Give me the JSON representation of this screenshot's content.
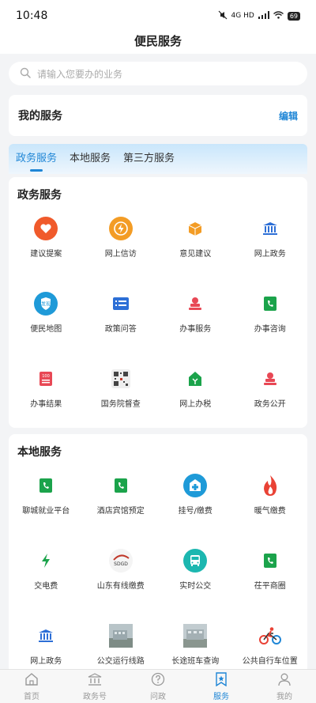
{
  "status": {
    "time": "10:48",
    "network": "4G HD",
    "battery": "69"
  },
  "header": {
    "title": "便民服务"
  },
  "search": {
    "placeholder": "请输入您要办的业务"
  },
  "my_services": {
    "title": "我的服务",
    "edit": "编辑"
  },
  "tabs": [
    {
      "label": "政务服务"
    },
    {
      "label": "本地服务"
    },
    {
      "label": "第三方服务"
    }
  ],
  "gov": {
    "title": "政务服务",
    "items": [
      {
        "label": "建议提案",
        "icon": "heart-icon",
        "color": "#f05a2b"
      },
      {
        "label": "网上信访",
        "icon": "lightning-icon",
        "color": "#f39c25"
      },
      {
        "label": "意见建议",
        "icon": "box-icon",
        "color": "#f39c25"
      },
      {
        "label": "网上政务",
        "icon": "government-icon",
        "color": "#2d6fd6"
      },
      {
        "label": "便民地图",
        "icon": "map-shield-icon",
        "color": "#1f9ad8",
        "badge": "发现"
      },
      {
        "label": "政策问答",
        "icon": "list-icon",
        "color": "#2d6fd6"
      },
      {
        "label": "办事服务",
        "icon": "stamp-icon",
        "color": "#e84855"
      },
      {
        "label": "办事咨询",
        "icon": "phone-book-icon",
        "color": "#1ba34b"
      },
      {
        "label": "办事结果",
        "icon": "result-icon",
        "color": "#e84855",
        "badge": "100"
      },
      {
        "label": "国务院督查",
        "icon": "qrcode-icon",
        "color": "#444444"
      },
      {
        "label": "网上办税",
        "icon": "tax-icon",
        "color": "#1ba34b"
      },
      {
        "label": "政务公开",
        "icon": "stamp-icon",
        "color": "#e84855"
      }
    ]
  },
  "local": {
    "title": "本地服务",
    "items": [
      {
        "label": "聊城就业平台",
        "icon": "phone-book-icon",
        "color": "#1ba34b"
      },
      {
        "label": "酒店宾馆预定",
        "icon": "phone-book-icon",
        "color": "#1ba34b"
      },
      {
        "label": "挂号/缴费",
        "icon": "hospital-icon",
        "color": "#1e9ad8"
      },
      {
        "label": "暖气缴费",
        "icon": "flame-icon",
        "color": "#e94235"
      },
      {
        "label": "交电费",
        "icon": "bolt-icon",
        "color": "#1ba34b"
      },
      {
        "label": "山东有线缴费",
        "icon": "cable-tv-logo-icon",
        "color": "#c0392b",
        "badge": "SDGD"
      },
      {
        "label": "实时公交",
        "icon": "bus-icon",
        "color": "#1cb7b0"
      },
      {
        "label": "茌平商圈",
        "icon": "phone-book-icon",
        "color": "#1ba34b"
      },
      {
        "label": "网上政务",
        "icon": "government-icon",
        "color": "#2d6fd6"
      },
      {
        "label": "公交运行线路",
        "icon": "photo-icon",
        "color": "#8aa0a8"
      },
      {
        "label": "长途班车查询",
        "icon": "photo-icon",
        "color": "#8aa0a8"
      },
      {
        "label": "公共自行车位置",
        "icon": "bicycle-icon",
        "color": "#e94235"
      }
    ]
  },
  "bottom_nav": [
    {
      "label": "首页",
      "icon": "home-icon"
    },
    {
      "label": "政务号",
      "icon": "building-icon"
    },
    {
      "label": "问政",
      "icon": "question-icon"
    },
    {
      "label": "服务",
      "icon": "service-star-icon",
      "active": true
    },
    {
      "label": "我的",
      "icon": "person-icon"
    }
  ]
}
